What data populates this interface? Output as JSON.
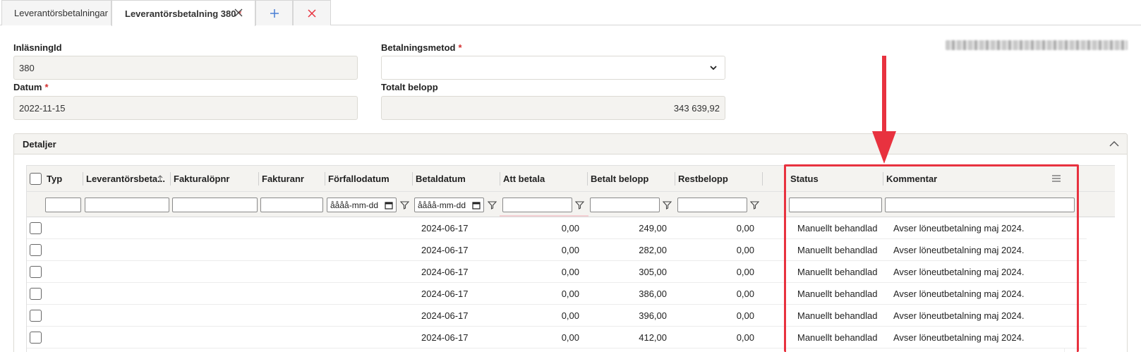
{
  "tabs": [
    {
      "label": "Leverantörsbetalningar"
    },
    {
      "label": "Leverantörsbetalning 380",
      "required_mark": "*"
    }
  ],
  "form": {
    "inlasning_label": "InläsningId",
    "inlasning_value": "380",
    "betalningsmetod_label": "Betalningsmetod",
    "betalningsmetod_value": "",
    "datum_label": "Datum",
    "datum_value": "2022-11-15",
    "totalt_label": "Totalt belopp",
    "totalt_value": "343 639,92",
    "required_mark": "*"
  },
  "panel": {
    "title": "Detaljer"
  },
  "grid": {
    "columns": [
      "Typ",
      "Leverantörsbeta...",
      "Fakturalöpnr",
      "Fakturanr",
      "Förfallodatum",
      "Betaldatum",
      "Att betala",
      "Betalt belopp",
      "Restbelopp",
      "Status",
      "Kommentar"
    ],
    "date_placeholder": "åååå-mm-dd",
    "rows": [
      {
        "betaldatum": "2024-06-17",
        "att_betala": "0,00",
        "betalt": "249,00",
        "rest": "0,00",
        "status": "Manuellt behandlad",
        "kommentar": "Avser löneutbetalning maj 2024."
      },
      {
        "betaldatum": "2024-06-17",
        "att_betala": "0,00",
        "betalt": "282,00",
        "rest": "0,00",
        "status": "Manuellt behandlad",
        "kommentar": "Avser löneutbetalning maj 2024."
      },
      {
        "betaldatum": "2024-06-17",
        "att_betala": "0,00",
        "betalt": "305,00",
        "rest": "0,00",
        "status": "Manuellt behandlad",
        "kommentar": "Avser löneutbetalning maj 2024."
      },
      {
        "betaldatum": "2024-06-17",
        "att_betala": "0,00",
        "betalt": "386,00",
        "rest": "0,00",
        "status": "Manuellt behandlad",
        "kommentar": "Avser löneutbetalning maj 2024."
      },
      {
        "betaldatum": "2024-06-17",
        "att_betala": "0,00",
        "betalt": "396,00",
        "rest": "0,00",
        "status": "Manuellt behandlad",
        "kommentar": "Avser löneutbetalning maj 2024."
      },
      {
        "betaldatum": "2024-06-17",
        "att_betala": "0,00",
        "betalt": "412,00",
        "rest": "0,00",
        "status": "Manuellt behandlad",
        "kommentar": "Avser löneutbetalning maj 2024."
      }
    ]
  },
  "icons": {
    "tab_close": "close-icon",
    "add_tab": "plus-icon",
    "close_all": "close-icon",
    "select_chevron": "chevron-down-icon",
    "panel_collapse": "chevron-up-icon",
    "sort": "arrow-up-icon",
    "filter": "funnel-icon",
    "calendar": "calendar-icon",
    "column_menu": "hamburger-menu-icon"
  },
  "colors": {
    "accent_red": "#e8323f",
    "required_red": "#d32f2f",
    "blue_plus": "#4a7fd4",
    "field_bg": "#f4f3f0"
  }
}
